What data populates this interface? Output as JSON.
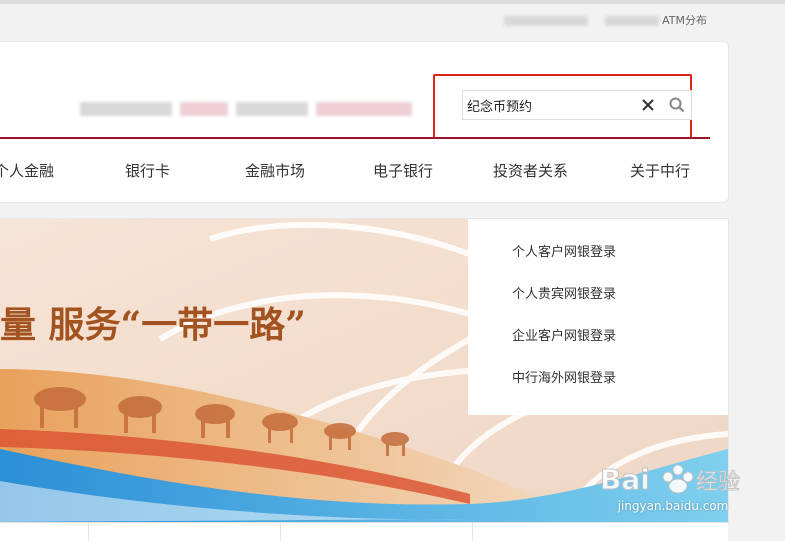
{
  "topbar": {
    "atm_label": "ATM分布"
  },
  "search": {
    "value": "纪念币预约"
  },
  "nav": {
    "items": [
      {
        "label": "个人金融"
      },
      {
        "label": "银行卡"
      },
      {
        "label": "金融市场"
      },
      {
        "label": "电子银行"
      },
      {
        "label": "投资者关系"
      },
      {
        "label": "关于中行"
      }
    ]
  },
  "banner": {
    "slogan": "量 服务“一带一路”"
  },
  "login_panel": {
    "links": [
      {
        "label": "个人客户网银登录"
      },
      {
        "label": "个人贵宾网银登录"
      },
      {
        "label": "企业客户网银登录"
      },
      {
        "label": "中行海外网银登录"
      }
    ]
  },
  "watermark": {
    "text": "jingyan.baidu.com"
  },
  "colors": {
    "brand_red": "#a0122a",
    "highlight_red": "#e2231a"
  }
}
